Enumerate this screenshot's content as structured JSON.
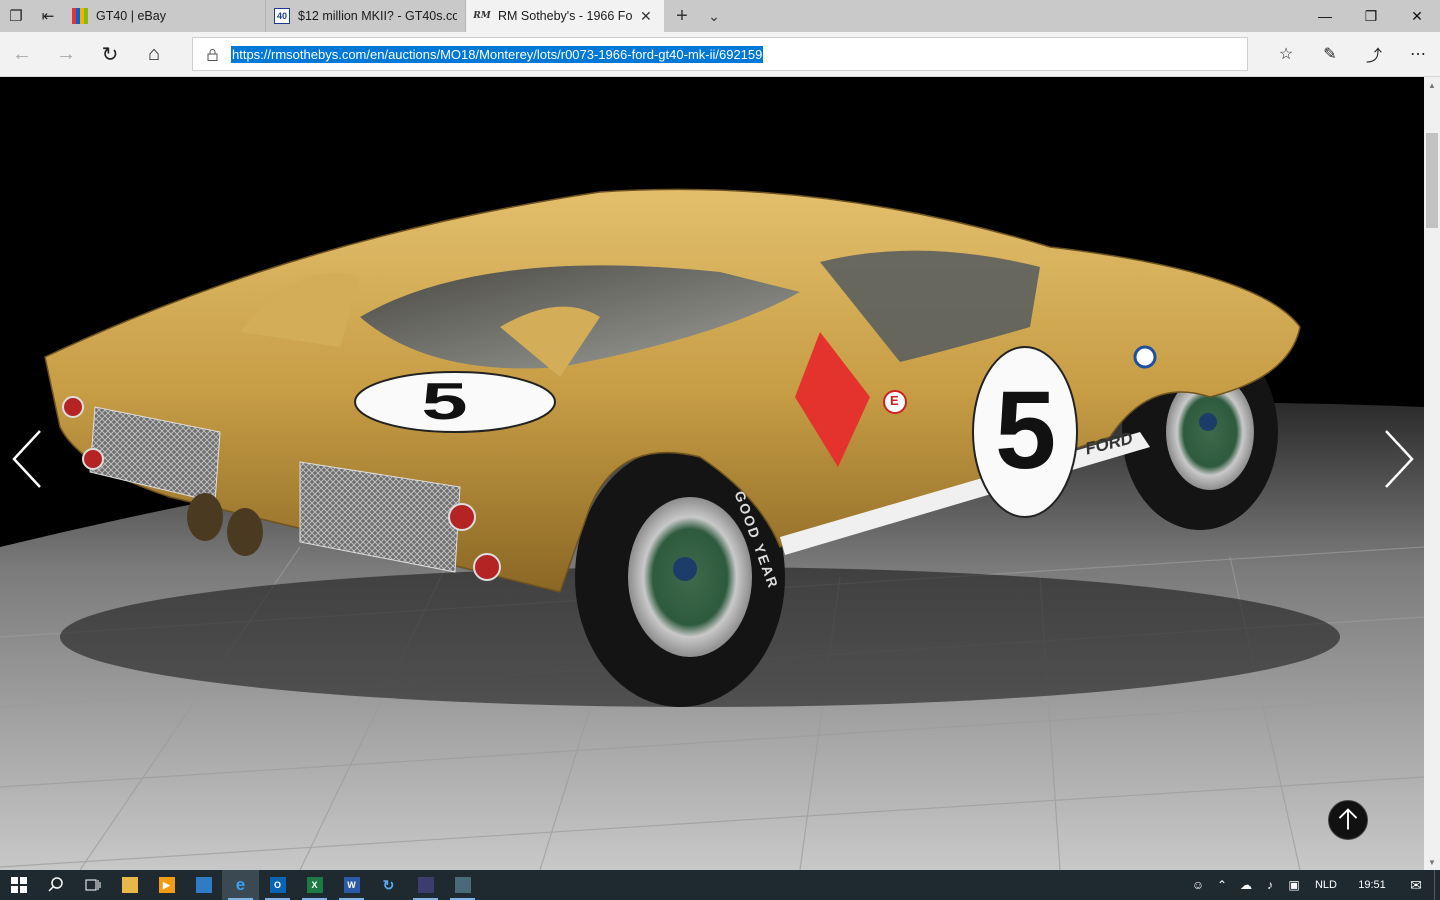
{
  "browser": {
    "tabs": [
      {
        "title": "GT40 | eBay",
        "favicon": "ebay-icon"
      },
      {
        "title": "$12 million MKII? - GT40s.co",
        "favicon": "gt40s-icon"
      },
      {
        "title": "RM Sotheby's - 1966 Fo",
        "favicon": "rm-sothebys-icon",
        "active": true
      }
    ],
    "favicon_gt40_text": "40",
    "favicon_rm_text": "RM",
    "address": {
      "url": "https://rmsothebys.com/en/auctions/MO18/Monterey/lots/r0073-1966-ford-gt40-mk-ii/692159"
    }
  },
  "gallery": {
    "car_number": "5",
    "side_lettering": "FORD",
    "tyre_lettering": "GOOD YEAR",
    "badge_letter": "E",
    "body_color": "#c9a04a",
    "roundel_color": "#ffffff"
  },
  "taskbar": {
    "apps": [
      "windows-start-icon",
      "search-icon",
      "task-view-icon",
      "file-explorer-icon",
      "media-player-icon",
      "calculator-icon",
      "edge-icon",
      "outlook-icon",
      "excel-icon",
      "word-icon",
      "sync-icon",
      "app-icon",
      "app2-icon"
    ],
    "language": "NLD",
    "time": "19:51"
  }
}
